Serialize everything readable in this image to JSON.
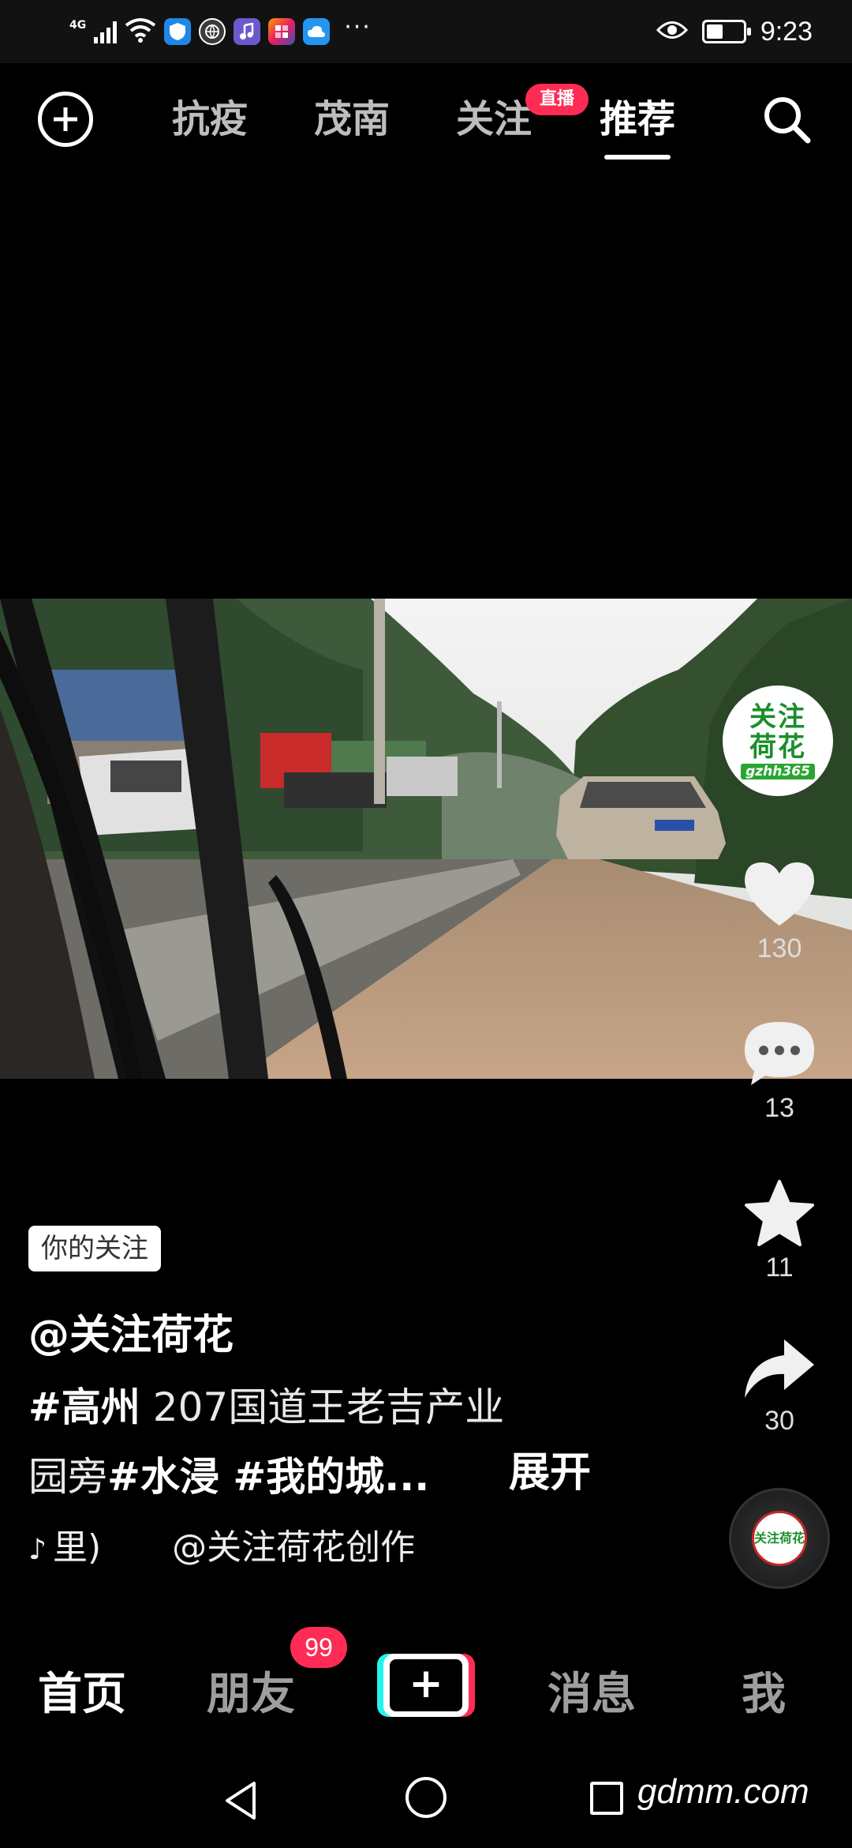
{
  "status_bar": {
    "network": "4G",
    "time": "9:23",
    "more": "···"
  },
  "top_nav": {
    "tabs": [
      {
        "label": "抗疫"
      },
      {
        "label": "茂南"
      },
      {
        "label": "关注"
      },
      {
        "label": "推荐"
      }
    ],
    "active_tab": "推荐",
    "live_badge": "直播"
  },
  "video": {
    "scene": "rainy highway flooded road"
  },
  "creator": {
    "avatar_text_1": "关注",
    "avatar_text_2": "荷花",
    "avatar_sub": "gzhh365"
  },
  "actions": {
    "likes": "130",
    "comments": "13",
    "favorites": "11",
    "shares": "30"
  },
  "caption": {
    "follow_tag": "你的关注",
    "author": "@关注荷花",
    "line1_tag": "#高州",
    "line1_text": " 207国道王老吉产业",
    "line2_text": "园旁",
    "line2_tag1": "#水浸",
    "line2_tag2": " #我的城...",
    "expand_label": "展开"
  },
  "music": {
    "note": "♪",
    "text_left": "里)",
    "text_right": "@关注荷花创作"
  },
  "disc": {
    "text": "关注荷花"
  },
  "bottom_nav": {
    "home": "首页",
    "friends": "朋友",
    "friends_badge": "99",
    "create": "+",
    "messages": "消息",
    "me": "我"
  },
  "watermark": "gdmm.com",
  "colors": {
    "accent": "#fe2c55",
    "cyan": "#25f4ee",
    "background": "#000000"
  }
}
